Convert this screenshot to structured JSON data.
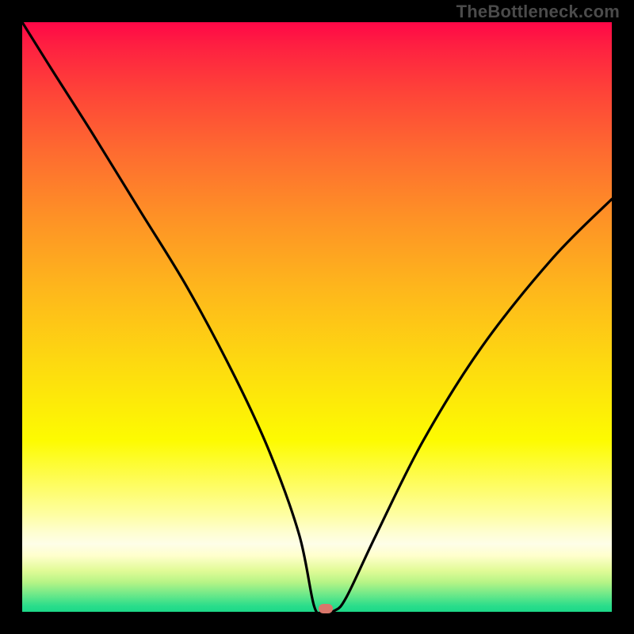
{
  "watermark": "TheBottleneck.com",
  "chart_data": {
    "type": "line",
    "title": "",
    "xlabel": "",
    "ylabel": "",
    "xlim": [
      0,
      100
    ],
    "ylim": [
      0,
      100
    ],
    "series": [
      {
        "name": "bottleneck-curve",
        "x": [
          0,
          5,
          12,
          20,
          28,
          36,
          42,
          47,
          49.5,
          51,
          53,
          55,
          60,
          68,
          78,
          90,
          100
        ],
        "y": [
          100,
          92,
          81,
          68,
          55,
          40,
          27,
          13,
          1,
          0,
          0.2,
          2.5,
          13,
          29,
          45,
          60,
          70
        ]
      }
    ],
    "marker": {
      "x": 51.5,
      "y": 0,
      "color": "#d9776b"
    },
    "gradient_stops": [
      {
        "pos": 0.0,
        "color": "#ff0747"
      },
      {
        "pos": 0.04,
        "color": "#fe2041"
      },
      {
        "pos": 0.12,
        "color": "#fe4438"
      },
      {
        "pos": 0.22,
        "color": "#fe6b30"
      },
      {
        "pos": 0.33,
        "color": "#fe9126"
      },
      {
        "pos": 0.45,
        "color": "#feb61c"
      },
      {
        "pos": 0.58,
        "color": "#fdda10"
      },
      {
        "pos": 0.71,
        "color": "#fdfb01"
      },
      {
        "pos": 0.835,
        "color": "#fefea2"
      },
      {
        "pos": 0.865,
        "color": "#fefed0"
      },
      {
        "pos": 0.885,
        "color": "#fefee8"
      },
      {
        "pos": 0.905,
        "color": "#ffffcc"
      },
      {
        "pos": 0.93,
        "color": "#e1fb97"
      },
      {
        "pos": 0.95,
        "color": "#b6f486"
      },
      {
        "pos": 0.97,
        "color": "#70e989"
      },
      {
        "pos": 0.99,
        "color": "#2add8b"
      },
      {
        "pos": 1.0,
        "color": "#1cd888"
      }
    ]
  }
}
